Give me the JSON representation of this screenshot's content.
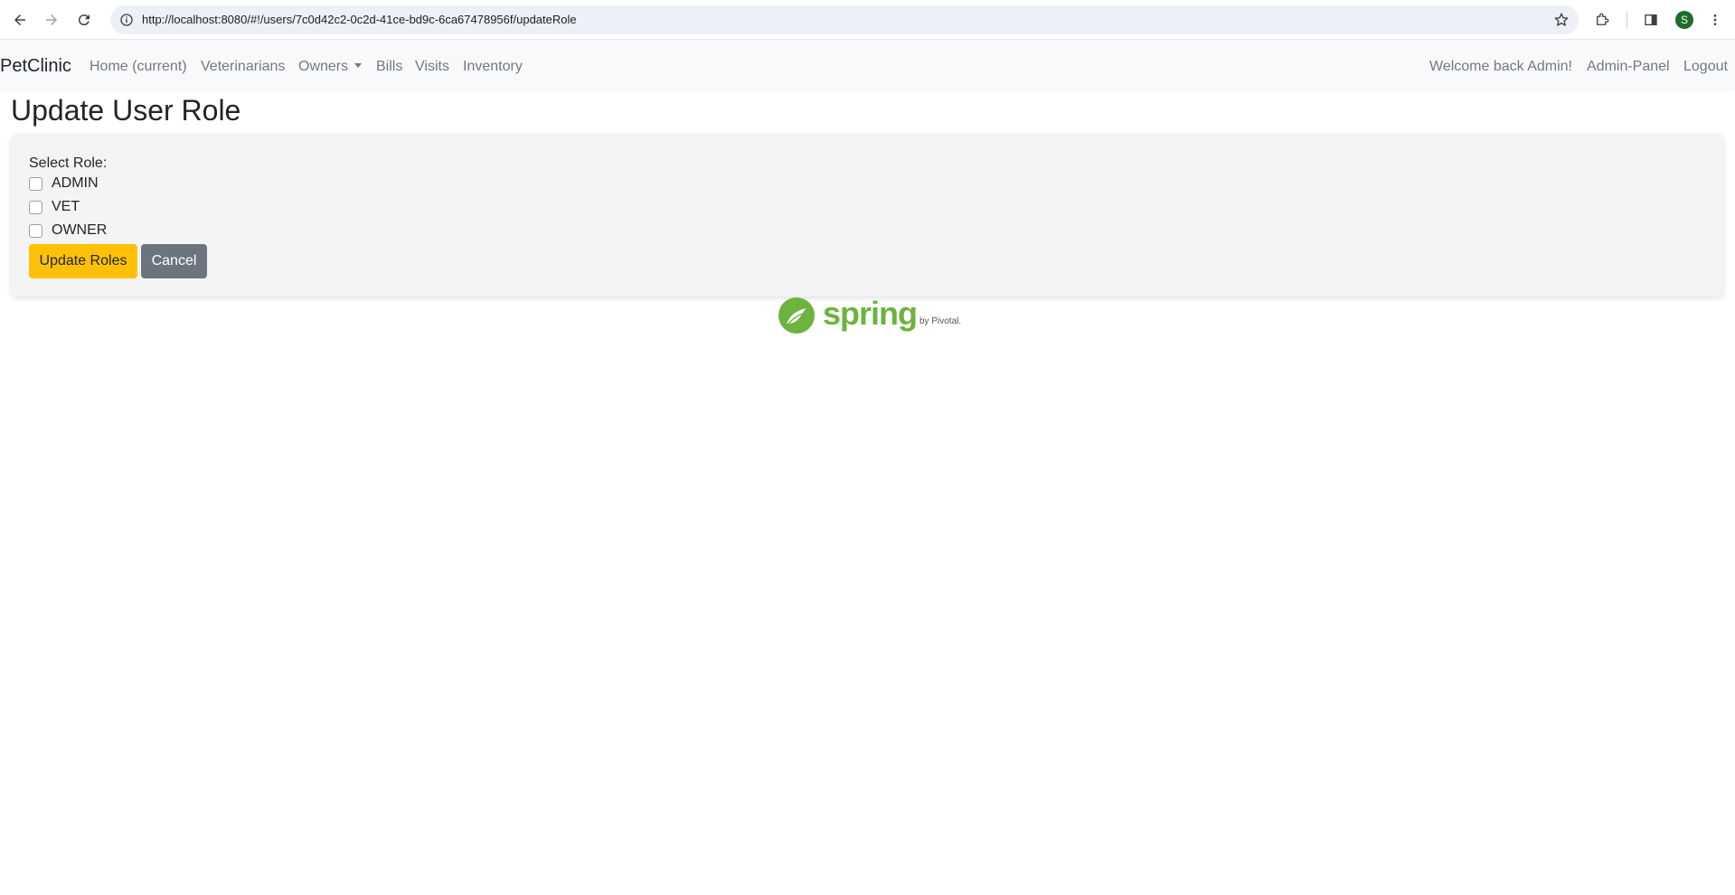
{
  "browser": {
    "url": "http://localhost:8080/#!/users/7c0d42c2-0c2d-41ce-bd9c-6ca67478956f/updateRole",
    "profile_initial": "S"
  },
  "navbar": {
    "brand": "PetClinic",
    "links": [
      "Home (current)",
      "Veterinarians",
      "Owners",
      "Bills",
      "Visits",
      "Inventory"
    ],
    "right": {
      "welcome": "Welcome back Admin!",
      "admin_panel": "Admin-Panel",
      "logout": "Logout"
    }
  },
  "page": {
    "title": "Update User Role",
    "select_label": "Select Role:",
    "roles": [
      {
        "label": "ADMIN",
        "checked": false
      },
      {
        "label": "VET",
        "checked": false
      },
      {
        "label": "OWNER",
        "checked": false
      }
    ],
    "update_button": "Update Roles",
    "cancel_button": "Cancel"
  },
  "footer": {
    "logo_word": "spring",
    "logo_by": "by Pivotal.",
    "brand_color": "#6db33f"
  },
  "colors": {
    "accent_warning": "#ffc107",
    "secondary": "#6c757d",
    "navbar_bg": "#f8f9fa"
  },
  "icons": [
    "back-arrow-icon",
    "forward-arrow-icon",
    "reload-icon",
    "site-info-icon",
    "bookmark-star-icon",
    "extensions-icon",
    "side-panel-icon",
    "more-menu-icon",
    "spring-leaf-icon"
  ]
}
